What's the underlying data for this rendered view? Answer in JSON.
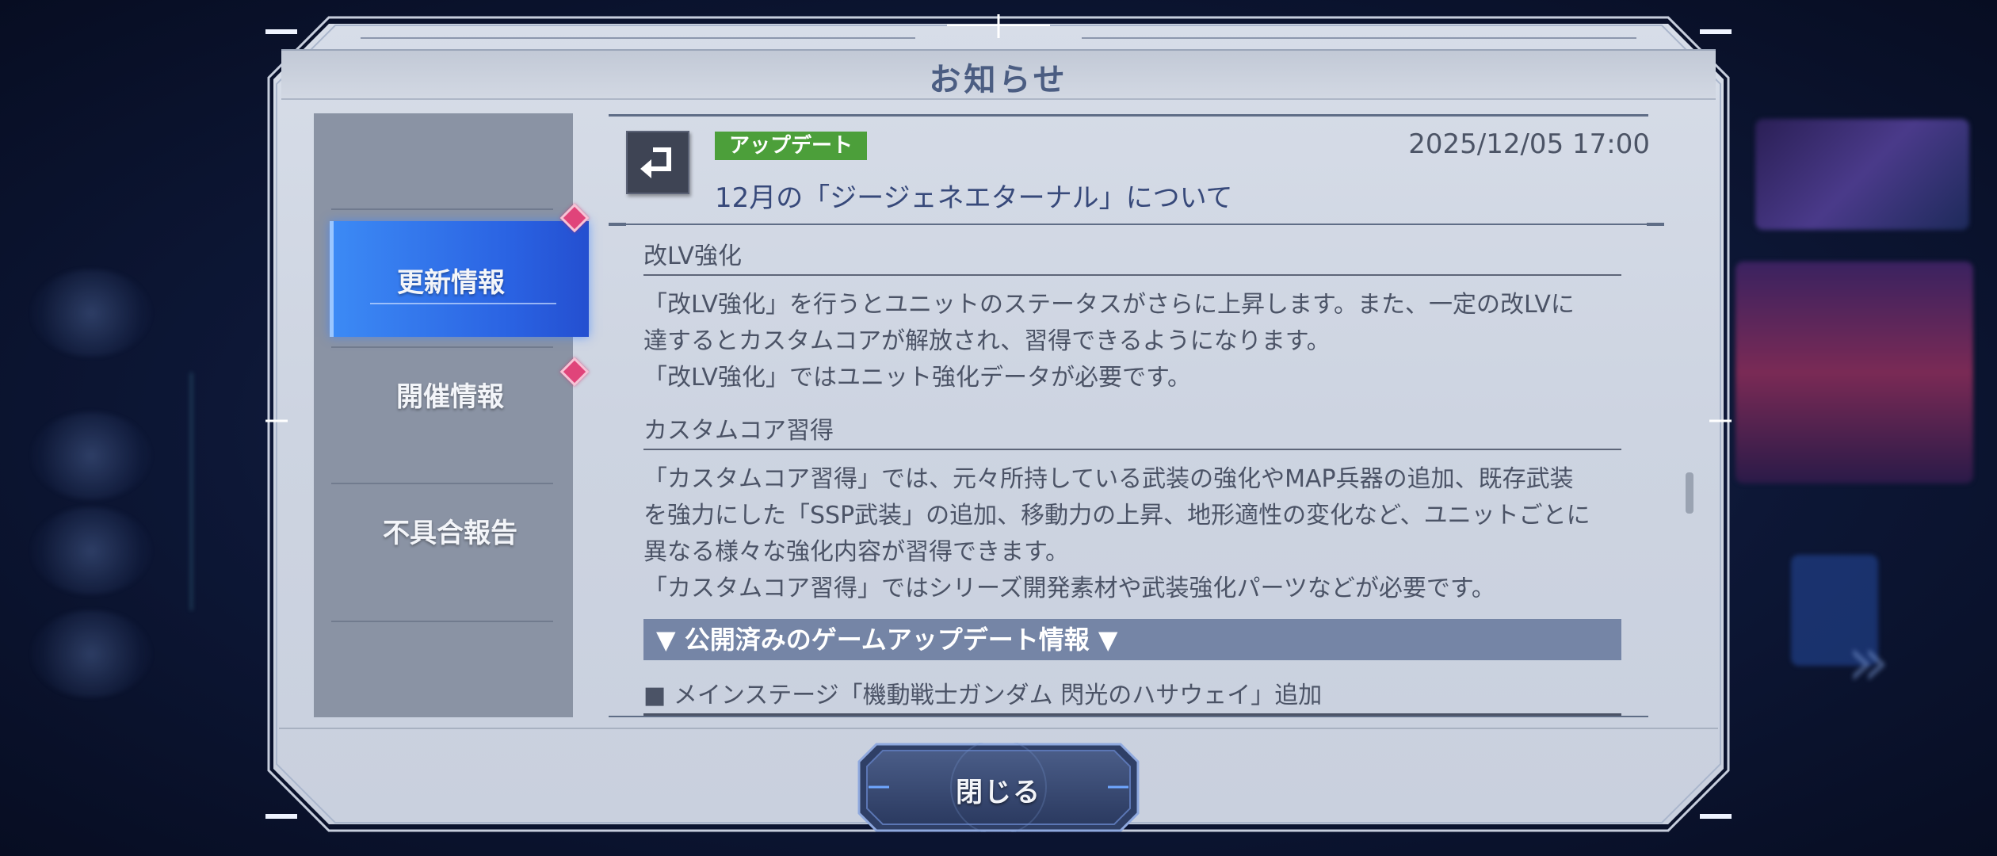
{
  "dialog": {
    "title": "お知らせ",
    "close_label": "閉じる"
  },
  "tabs": [
    {
      "label": "更新情報",
      "active": true
    },
    {
      "label": "開催情報",
      "active": false
    },
    {
      "label": "不具合報告",
      "active": false
    }
  ],
  "news": {
    "icon": "update-arrow-icon",
    "category": "アップデート",
    "category_color": "#4c9f3a",
    "date": "2025/12/05 17:00",
    "title": "12月の「ジージェネエターナル」について",
    "sections": [
      {
        "heading": "改LV強化",
        "lines": [
          "「改LV強化」を行うとユニットのステータスがさらに上昇します。また、一定の改LVに",
          "達するとカスタムコアが解放され、習得できるようになります。",
          "「改LV強化」ではユニット強化データが必要です。"
        ]
      },
      {
        "heading": "カスタムコア習得",
        "lines": [
          "「カスタムコア習得」では、元々所持している武装の強化やMAP兵器の追加、既存武装",
          "を強力にした「SSP武装」の追加、移動力の上昇、地形適性の変化など、ユニットごとに",
          "異なる様々な強化内容が習得できます。",
          "「カスタムコア習得」ではシリーズ開発素材や武装強化パーツなどが必要です。"
        ]
      }
    ],
    "expand_label": "▼ 公開済みのゲームアップデート情報 ▼",
    "item_line": "■ メインステージ「機動戦士ガンダム 閃光のハサウェイ」追加"
  },
  "colors": {
    "active_tab": "#2f6ff0",
    "notice_diamond": "#e0447a",
    "expand_bar": "#7585a6"
  }
}
